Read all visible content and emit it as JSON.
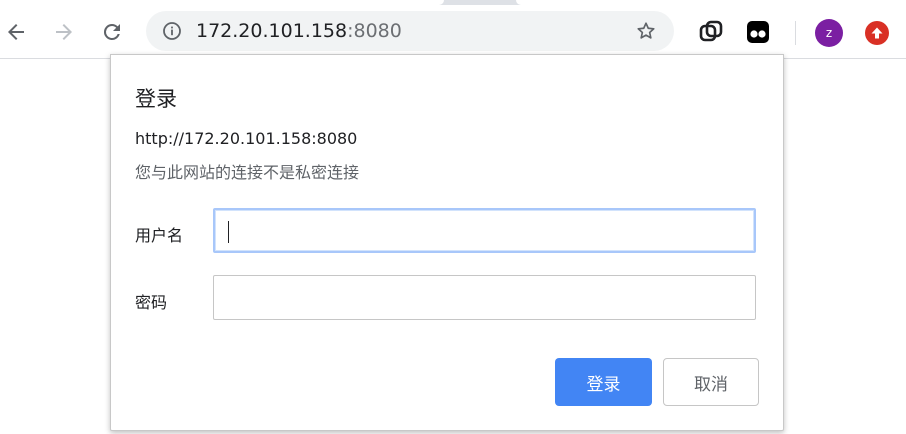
{
  "browser": {
    "url_host": "172.20.101.158",
    "url_port": ":8080",
    "profile_initial": "z"
  },
  "dialog": {
    "title": "登录",
    "site_url": "http://172.20.101.158:8080",
    "warning": "您与此网站的连接不是私密连接",
    "username_label": "用户名",
    "username_value": "",
    "password_label": "密码",
    "password_value": "",
    "login_button": "登录",
    "cancel_button": "取消"
  },
  "colors": {
    "primary_button": "#4285f4",
    "avatar": "#7b1fa2",
    "update_badge": "#d93025"
  }
}
